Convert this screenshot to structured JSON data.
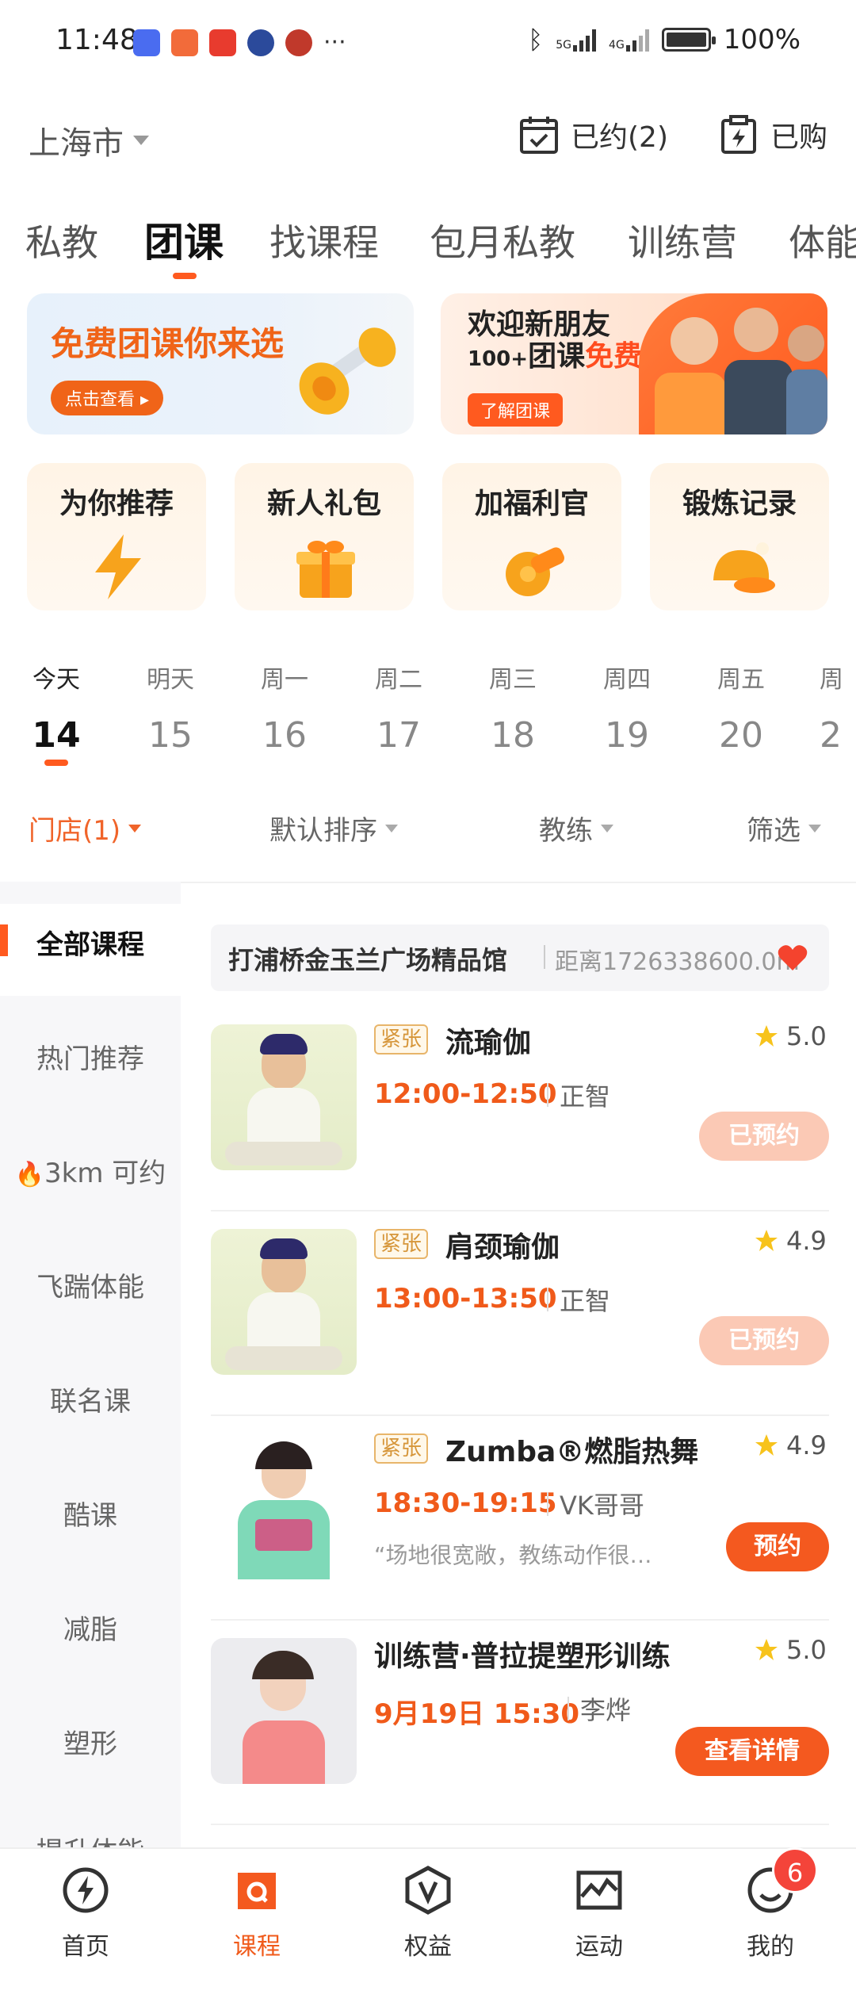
{
  "status_bar": {
    "time": "11:48",
    "more": "···",
    "battery": "100%",
    "network1": "5G",
    "network2": "4G"
  },
  "header": {
    "city": "上海市",
    "booked": "已约(2)",
    "purchased": "已购"
  },
  "tabs": [
    {
      "label": "私教"
    },
    {
      "label": "团课",
      "active": true
    },
    {
      "label": "找课程"
    },
    {
      "label": "包月私教"
    },
    {
      "label": "训练营"
    },
    {
      "label": "体能"
    }
  ],
  "banners": {
    "left_title": "免费团课你来选",
    "left_button": "点击查看",
    "right_title_line1": "欢迎新朋友",
    "right_title_line2_a": "100+",
    "right_title_line2_b": "团课",
    "right_title_line2_c": "免费上",
    "right_button": "了解团课"
  },
  "quick_entries": [
    {
      "label": "为你推荐",
      "icon": "lightning-icon"
    },
    {
      "label": "新人礼包",
      "icon": "gift-icon"
    },
    {
      "label": "加福利官",
      "icon": "whistle-icon"
    },
    {
      "label": "锻炼记录",
      "icon": "cap-icon"
    }
  ],
  "dates": [
    {
      "weekday": "今天",
      "day": "14",
      "active": true
    },
    {
      "weekday": "明天",
      "day": "15"
    },
    {
      "weekday": "周一",
      "day": "16"
    },
    {
      "weekday": "周二",
      "day": "17"
    },
    {
      "weekday": "周三",
      "day": "18"
    },
    {
      "weekday": "周四",
      "day": "19"
    },
    {
      "weekday": "周五",
      "day": "20"
    },
    {
      "weekday": "周",
      "day": "2"
    }
  ],
  "filters": {
    "store": "门店(1)",
    "sort": "默认排序",
    "coach": "教练",
    "filter": "筛选"
  },
  "sidebar": [
    {
      "label": "全部课程",
      "active": true
    },
    {
      "label": "热门推荐"
    },
    {
      "label": "3km 可约"
    },
    {
      "label": "飞踹体能"
    },
    {
      "label": "联名课"
    },
    {
      "label": "酷课"
    },
    {
      "label": "减脂"
    },
    {
      "label": "塑形"
    },
    {
      "label": "提升体能"
    }
  ],
  "store": {
    "name": "打浦桥金玉兰广场精品馆",
    "distance": "距离1726338600.0m"
  },
  "courses": [
    {
      "tag": "紧张",
      "title": "流瑜伽",
      "rating": "5.0",
      "time": "12:00-12:50",
      "coach": "正智",
      "review": "",
      "button": "已预约"
    },
    {
      "tag": "紧张",
      "title": "肩颈瑜伽",
      "rating": "4.9",
      "time": "13:00-13:50",
      "coach": "正智",
      "review": "",
      "button": "已预约"
    },
    {
      "tag": "紧张",
      "title": "Zumba®燃脂热舞",
      "rating": "4.9",
      "time": "18:30-19:15",
      "coach": "VK哥哥",
      "review": "“场地很宽敞，教练动作很…",
      "button": "预约"
    },
    {
      "tag": "",
      "title": "训练营·普拉提塑形训练",
      "rating": "5.0",
      "time": "9月19日 15:30",
      "coach": "李烨",
      "review": "",
      "button": "查看详情"
    }
  ],
  "bottom_nav": [
    {
      "label": "首页",
      "icon": "home-lightning-icon"
    },
    {
      "label": "课程",
      "icon": "course-icon",
      "active": true
    },
    {
      "label": "权益",
      "icon": "v-shield-icon"
    },
    {
      "label": "运动",
      "icon": "sport-chart-icon"
    },
    {
      "label": "我的",
      "icon": "smile-icon",
      "badge": "6"
    }
  ],
  "colors": {
    "accent": "#f4591f",
    "booked_button": "#fbc9b5",
    "tag_border": "#e8b56a",
    "badge": "#f4443a"
  }
}
